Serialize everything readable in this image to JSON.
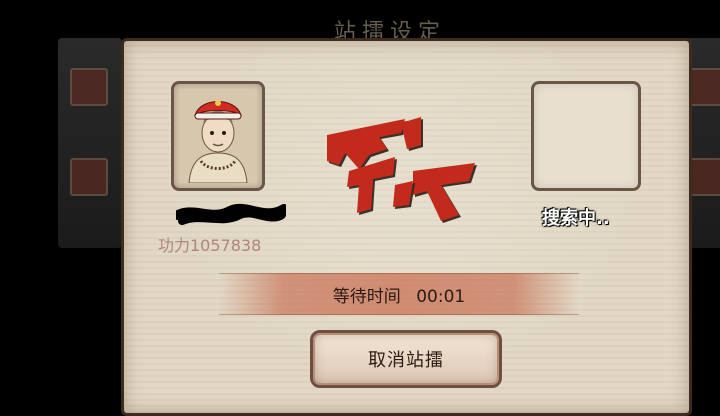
{
  "background": {
    "title": "站擂设定"
  },
  "player": {
    "avatar": "monk-portrait",
    "name": "",
    "power_text": "功力1057838"
  },
  "vs": {
    "text": "对决",
    "color": "#c22b1b"
  },
  "opponent": {
    "status": "搜索中.."
  },
  "timer": {
    "label": "等待时间",
    "value": "00:01"
  },
  "actions": {
    "cancel_label": "取消站擂"
  },
  "colors": {
    "panel": "#e2d8c4",
    "accent_red": "#c22b1b",
    "power_text": "#b0867b",
    "timer_bar": "#c0583a",
    "frame_border": "#6a5646"
  },
  "icons": {
    "player_avatar": "monk-avatar-icon",
    "vs_emblem": "vs-emblem-icon"
  }
}
